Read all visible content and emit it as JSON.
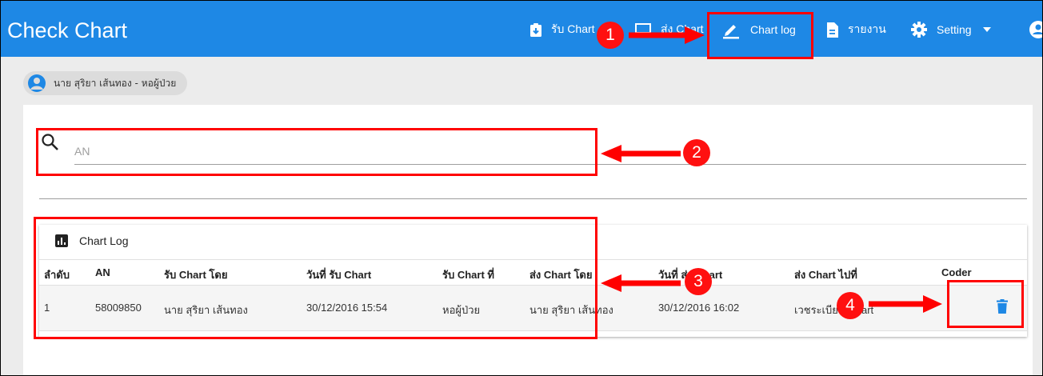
{
  "app": {
    "title": "Check Chart"
  },
  "nav": [
    {
      "label": "รับ Chart",
      "icon": "clipboard-download-icon"
    },
    {
      "label": "ส่ง Chart",
      "icon": "monitor-icon"
    },
    {
      "label": "Chart log",
      "icon": "pencil-icon"
    },
    {
      "label": "รายงาน",
      "icon": "document-icon"
    },
    {
      "label": "Setting",
      "icon": "gear-icon",
      "dropdown": "caret-down-icon"
    },
    {
      "label": "",
      "icon": "account-icon"
    }
  ],
  "user_chip": {
    "label": "นาย สุริยา เส้นทอง - หอผู้ป่วย",
    "icon": "user-avatar-icon"
  },
  "search": {
    "placeholder": "AN",
    "value": "",
    "icon": "search-icon"
  },
  "chart_log": {
    "title": "Chart Log",
    "icon": "bar-chart-icon",
    "columns": [
      "ลำดับ",
      "AN",
      "รับ Chart โดย",
      "วันที่ รับ Chart",
      "รับ Chart ที่",
      "ส่ง Chart โดย",
      "วันที่ ส่ง Chart",
      "ส่ง Chart ไปที่",
      "Coder"
    ],
    "rows": [
      [
        "1",
        "58009850",
        "นาย สุริยา เส้นทอง",
        "30/12/2016 15:54",
        "หอผู้ป่วย",
        "นาย สุริยา เส้นทอง",
        "30/12/2016 16:02",
        "เวชระเบียน Chart",
        ""
      ]
    ],
    "row_action_icon": "trash-icon"
  },
  "annotations": [
    "1",
    "2",
    "3",
    "4"
  ],
  "colors": {
    "appbar": "#1e88e5",
    "highlight": "#ff0000",
    "accent_icon": "#1e88e5"
  }
}
